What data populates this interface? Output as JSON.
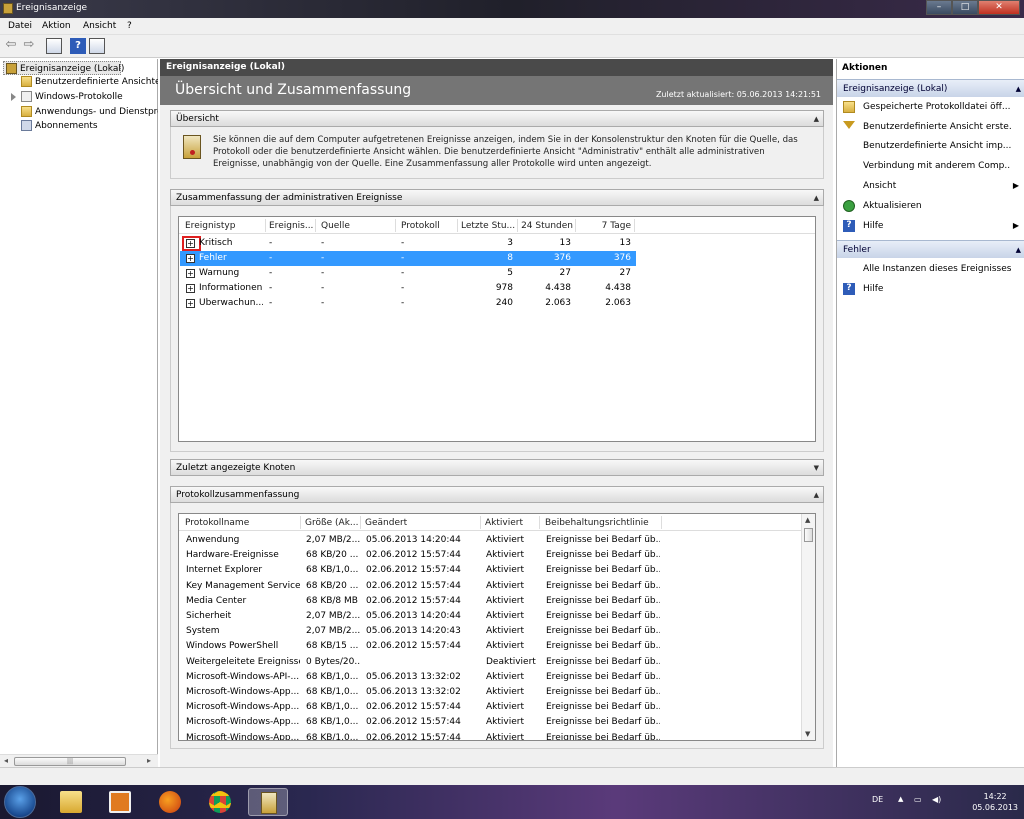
{
  "window": {
    "title": "Ereignisanzeige"
  },
  "menu": [
    "Datei",
    "Aktion",
    "Ansicht",
    "?"
  ],
  "toolbar": {
    "icons": [
      "back-arrow-icon",
      "forward-arrow-icon",
      "console-tree-icon",
      "help-icon",
      "properties-icon"
    ]
  },
  "tree": {
    "root": "Ereignisanzeige (Lokal)",
    "items": [
      "Benutzerdefinierte Ansichten",
      "Windows-Protokolle",
      "Anwendungs- und Dienstprotokolle",
      "Abonnements"
    ]
  },
  "center": {
    "header": "Ereignisanzeige (Lokal)",
    "title": "Übersicht und Zusammenfassung",
    "updated": "Zuletzt aktualisiert: 05.06.2013 14:21:51",
    "overview": {
      "title": "Übersicht",
      "text": "Sie können die auf dem Computer aufgetretenen Ereignisse anzeigen, indem Sie in der Konsolenstruktur den Knoten für die Quelle, das Protokoll oder die benutzerdefinierte Ansicht wählen. Die benutzerdefinierte Ansicht \"Administrativ\" enthält alle administrativen Ereignisse, unabhängig von der Quelle. Eine Zusammenfassung aller Protokolle wird unten angezeigt."
    },
    "summary": {
      "title": "Zusammenfassung der administrativen Ereignisse",
      "columns": [
        "Ereignistyp",
        "Ereignis...",
        "Quelle",
        "Protokoll",
        "Letzte Stu...",
        "24 Stunden",
        "7 Tage"
      ],
      "rows": [
        {
          "type": "Kritisch",
          "event": "-",
          "source": "-",
          "log": "-",
          "hour": "3",
          "day": "13",
          "week": "13"
        },
        {
          "type": "Fehler",
          "event": "-",
          "source": "-",
          "log": "-",
          "hour": "8",
          "day": "376",
          "week": "376"
        },
        {
          "type": "Warnung",
          "event": "-",
          "source": "-",
          "log": "-",
          "hour": "5",
          "day": "27",
          "week": "27"
        },
        {
          "type": "Informationen",
          "event": "-",
          "source": "-",
          "log": "-",
          "hour": "978",
          "day": "4.438",
          "week": "4.438"
        },
        {
          "type": "Überwachun...",
          "event": "-",
          "source": "-",
          "log": "-",
          "hour": "240",
          "day": "2.063",
          "week": "2.063"
        }
      ]
    },
    "recent": {
      "title": "Zuletzt angezeigte Knoten"
    },
    "logs": {
      "title": "Protokollzusammenfassung",
      "columns": [
        "Protokollname",
        "Größe (Ak...",
        "Geändert",
        "Aktiviert",
        "Beibehaltungsrichtlinie"
      ],
      "rows": [
        [
          "Anwendung",
          "2,07 MB/2...",
          "05.06.2013 14:20:44",
          "Aktiviert",
          "Ereignisse bei Bedarf üb..."
        ],
        [
          "Hardware-Ereignisse",
          "68 KB/20 ...",
          "02.06.2012 15:57:44",
          "Aktiviert",
          "Ereignisse bei Bedarf üb..."
        ],
        [
          "Internet Explorer",
          "68 KB/1,0...",
          "02.06.2012 15:57:44",
          "Aktiviert",
          "Ereignisse bei Bedarf üb..."
        ],
        [
          "Key Management Service",
          "68 KB/20 ...",
          "02.06.2012 15:57:44",
          "Aktiviert",
          "Ereignisse bei Bedarf üb..."
        ],
        [
          "Media Center",
          "68 KB/8 MB",
          "02.06.2012 15:57:44",
          "Aktiviert",
          "Ereignisse bei Bedarf üb..."
        ],
        [
          "Sicherheit",
          "2,07 MB/2...",
          "05.06.2013 14:20:44",
          "Aktiviert",
          "Ereignisse bei Bedarf üb..."
        ],
        [
          "System",
          "2,07 MB/2...",
          "05.06.2013 14:20:43",
          "Aktiviert",
          "Ereignisse bei Bedarf üb..."
        ],
        [
          "Windows PowerShell",
          "68 KB/15 ...",
          "02.06.2012 15:57:44",
          "Aktiviert",
          "Ereignisse bei Bedarf üb..."
        ],
        [
          "Weitergeleitete Ereignisse",
          "0 Bytes/20...",
          "",
          "Deaktiviert",
          "Ereignisse bei Bedarf üb..."
        ],
        [
          "Microsoft-Windows-API-...",
          "68 KB/1,0...",
          "05.06.2013 13:32:02",
          "Aktiviert",
          "Ereignisse bei Bedarf üb..."
        ],
        [
          "Microsoft-Windows-App...",
          "68 KB/1,0...",
          "05.06.2013 13:32:02",
          "Aktiviert",
          "Ereignisse bei Bedarf üb..."
        ],
        [
          "Microsoft-Windows-App...",
          "68 KB/1,0...",
          "02.06.2012 15:57:44",
          "Aktiviert",
          "Ereignisse bei Bedarf üb..."
        ],
        [
          "Microsoft-Windows-App...",
          "68 KB/1,0...",
          "02.06.2012 15:57:44",
          "Aktiviert",
          "Ereignisse bei Bedarf üb..."
        ],
        [
          "Microsoft-Windows-App...",
          "68 KB/1,0...",
          "02.06.2012 15:57:44",
          "Aktiviert",
          "Ereignisse bei Bedarf üb..."
        ]
      ]
    }
  },
  "actions": {
    "header": "Aktionen",
    "section1": "Ereignisanzeige (Lokal)",
    "items1": [
      "Gespeicherte Protokolldatei öff...",
      "Benutzerdefinierte Ansicht erste...",
      "Benutzerdefinierte Ansicht imp...",
      "Verbindung mit anderem Comp...",
      "Ansicht",
      "Aktualisieren",
      "Hilfe"
    ],
    "section2": "Fehler",
    "items2": [
      "Alle Instanzen dieses Ereignisses...",
      "Hilfe"
    ]
  },
  "taskbar": {
    "lang": "DE",
    "time": "14:22",
    "date": "05.06.2013",
    "accent": "#3399ff"
  }
}
